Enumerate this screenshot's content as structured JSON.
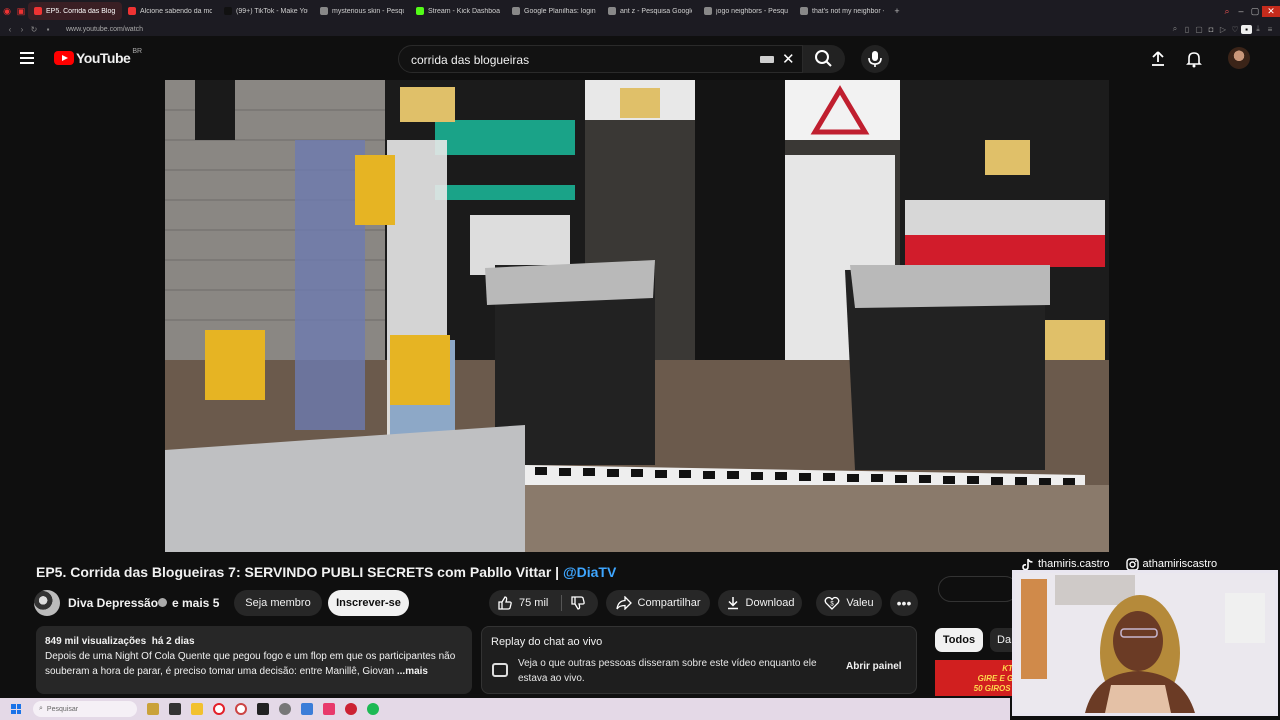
{
  "browser": {
    "tabs": [
      {
        "title": "EP5. Corrida das Blog",
        "color": "#e33"
      },
      {
        "title": "Alcione sabendo da mort",
        "color": "#e33"
      },
      {
        "title": "(99+) TikTok - Make Your",
        "color": "#111"
      },
      {
        "title": "mysterious skin - Pesquis",
        "color": "#888"
      },
      {
        "title": "Stream - Kick Dashboard",
        "color": "#53fc18"
      },
      {
        "title": "Google Planilhas: login",
        "color": "#888"
      },
      {
        "title": "ant z - Pesquisa Google",
        "color": "#888"
      },
      {
        "title": "jogo neighbors - Pesquis",
        "color": "#888"
      },
      {
        "title": "that's not my neighbor - P",
        "color": "#888"
      }
    ],
    "new_tab": "+",
    "url": "www.youtube.com/watch"
  },
  "youtube": {
    "logo_text": "YouTube",
    "country": "BR",
    "search_value": "corrida das blogueiras"
  },
  "video": {
    "title": "EP5. Corrida das Blogueiras 7: SERVINDO PUBLI SECRETS com Pabllo Vittar | ",
    "title_tag": "@DiaTV",
    "channel": "Diva Depressão",
    "channel_more": "e mais 5",
    "join_label": "Seja membro",
    "subscribe_label": "Inscrever-se",
    "likes": "75 mil",
    "share_label": "Compartilhar",
    "download_label": "Download",
    "thanks_label": "Valeu",
    "more_label": "•••"
  },
  "description": {
    "views": "849 mil visualizações",
    "date": "há 2 dias",
    "text": "Depois de uma Night Of Cola Quente que pegou fogo e um flop em que os participantes não souberam a hora de parar, é preciso tomar uma decisão: entre Manillê, Giovan",
    "more": "...mais"
  },
  "chat_replay": {
    "title": "Replay do chat ao vivo",
    "text": "Veja o que outras pessoas disseram sobre este vídeo enquanto ele estava ao vivo.",
    "open_label": "Abrir painel"
  },
  "sidebar": {
    "chip_all": "Todos",
    "chip_next": "Da",
    "ad_line1": "KTO",
    "ad_line2": "GIRE E GA",
    "ad_line3": "50 GIROS G"
  },
  "overlay": {
    "tiktok_handle": "thamiris.castro",
    "instagram_handle": "athamiriscastro"
  },
  "taskbar": {
    "search_placeholder": "Pesquisar"
  }
}
